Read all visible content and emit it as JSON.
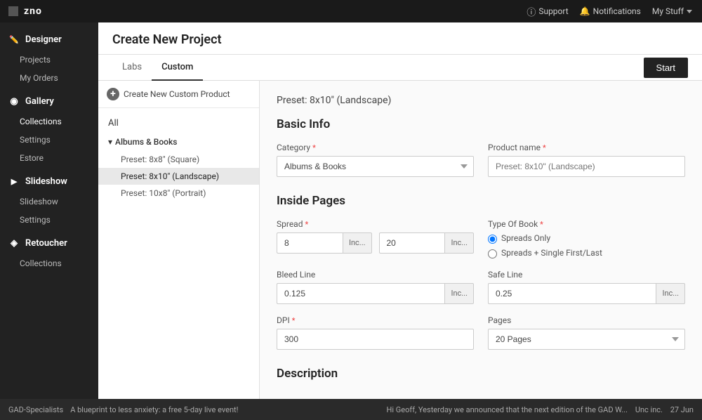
{
  "topNav": {
    "logo": "zno",
    "logoIcon": "□",
    "support": "Support",
    "notifications": "Notifications",
    "myStuff": "My Stuff"
  },
  "sidebar": {
    "sections": [
      {
        "id": "designer",
        "label": "Designer",
        "icon": "designer-icon",
        "items": [
          {
            "id": "projects",
            "label": "Projects"
          },
          {
            "id": "my-orders",
            "label": "My Orders"
          }
        ]
      },
      {
        "id": "gallery",
        "label": "Gallery",
        "icon": "gallery-icon",
        "items": [
          {
            "id": "collections",
            "label": "Collections"
          },
          {
            "id": "settings",
            "label": "Settings"
          },
          {
            "id": "estore",
            "label": "Estore"
          }
        ]
      },
      {
        "id": "slideshow",
        "label": "Slideshow",
        "icon": "slideshow-icon",
        "items": [
          {
            "id": "slideshow-sub",
            "label": "Slideshow"
          },
          {
            "id": "settings-slide",
            "label": "Settings"
          }
        ]
      },
      {
        "id": "retoucher",
        "label": "Retoucher",
        "icon": "retoucher-icon",
        "items": [
          {
            "id": "collections-ret",
            "label": "Collections"
          }
        ]
      }
    ]
  },
  "header": {
    "title": "Create New Project"
  },
  "tabs": {
    "items": [
      {
        "id": "labs",
        "label": "Labs",
        "active": false
      },
      {
        "id": "custom",
        "label": "Custom",
        "active": true
      }
    ],
    "startButton": "Start"
  },
  "leftPanel": {
    "createButton": "Create New Custom Product",
    "allLabel": "All",
    "groups": [
      {
        "label": "Albums & Books",
        "items": [
          {
            "label": "Preset: 8x8\" (Square)",
            "selected": false
          },
          {
            "label": "Preset: 8x10\" (Landscape)",
            "selected": true
          },
          {
            "label": "Preset: 10x8\" (Portrait)",
            "selected": false
          }
        ]
      }
    ]
  },
  "rightPanel": {
    "presetLabel": "Preset: 8x10\" (Landscape)",
    "basicInfo": {
      "sectionTitle": "Basic Info",
      "category": {
        "label": "Category",
        "required": true,
        "value": "Albums & Books"
      },
      "productName": {
        "label": "Product name",
        "required": true,
        "placeholder": "Preset: 8x10\" (Landscape)"
      }
    },
    "insidePages": {
      "sectionTitle": "Inside Pages",
      "spread": {
        "label": "Spread",
        "required": true,
        "value1": "8",
        "unit1": "Inc...",
        "value2": "20",
        "unit2": "Inc..."
      },
      "typeOfBook": {
        "label": "Type Of Book",
        "required": true,
        "options": [
          {
            "label": "Spreads Only",
            "selected": true
          },
          {
            "label": "Spreads + Single First/Last",
            "selected": false
          }
        ]
      },
      "bleedLine": {
        "label": "Bleed Line",
        "value": "0.125",
        "unit": "Inc..."
      },
      "safeLine": {
        "label": "Safe Line",
        "value": "0.25",
        "unit": "Inc..."
      },
      "dpi": {
        "label": "DPI",
        "required": true,
        "value": "300"
      },
      "pages": {
        "label": "Pages",
        "value": "20 Pages"
      }
    },
    "description": {
      "sectionTitle": "Description"
    }
  },
  "bottomBar": {
    "channelName": "GAD-Specialists",
    "message": "A blueprint to less anxiety: a free 5-day live event!",
    "notification": "Hi Geoff, Yesterday we announced that the next edition of the GAD W...",
    "timestamp": "27 Jun",
    "unreadLabel": "Unc",
    "incLabel": "inc."
  }
}
